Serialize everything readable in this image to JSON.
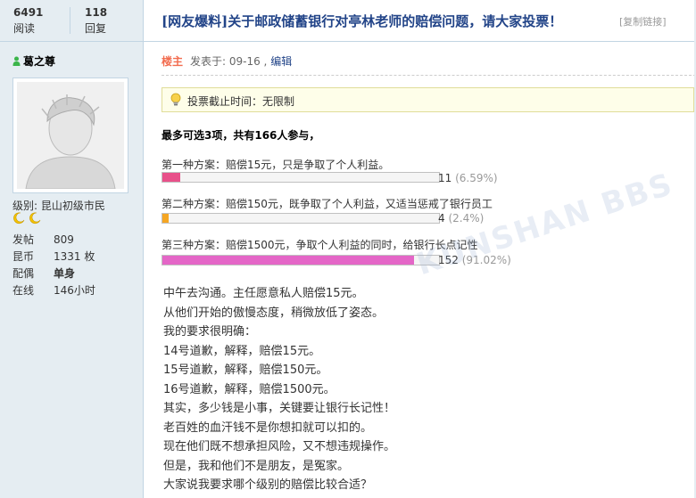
{
  "stats": {
    "views_value": "6491",
    "views_label": "阅读",
    "replies_value": "118",
    "replies_label": "回复"
  },
  "author": {
    "name": "葛之尊",
    "level": "级别: 昆山初级市民",
    "info": [
      {
        "key": "发帖",
        "value": "809"
      },
      {
        "key": "昆币",
        "value": "1331 枚"
      },
      {
        "key": "配偶",
        "value": "单身"
      },
      {
        "key": "在线",
        "value": "146小时"
      }
    ]
  },
  "thread": {
    "title": "[网友爆料]关于邮政储蓄银行对亭林老师的赔偿问题，请大家投票！",
    "copy_link": "[复制链接]"
  },
  "post": {
    "owner_label": "楼主",
    "posted_at": "发表于: 09-16 ,",
    "edit_label": "编辑"
  },
  "poll": {
    "deadline": "投票截止时间：无限制",
    "summary": "最多可选3项，共有166人参与，",
    "options": [
      {
        "label": "第一种方案：赔偿15元，只是争取了个人利益。",
        "count": "11",
        "percent": "(6.59%)",
        "fraction": 0.0659,
        "color": "#e8508a"
      },
      {
        "label": "第二种方案：赔偿150元，既争取了个人利益，又适当惩戒了银行员工",
        "count": "4",
        "percent": "(2.4%)",
        "fraction": 0.024,
        "color": "#f5a623"
      },
      {
        "label": "第三种方案：赔偿1500元，争取个人利益的同时，给银行长点记性",
        "count": "152",
        "percent": "(91.02%)",
        "fraction": 0.9102,
        "color": "#e466c7"
      }
    ]
  },
  "content": {
    "lines": [
      "中午去沟通。主任愿意私人赔偿15元。",
      "从他们开始的傲慢态度，稍微放低了姿态。",
      "我的要求很明确：",
      "14号道歉，解释，赔偿15元。",
      "15号道歉，解释，赔偿150元。",
      "16号道歉，解释，赔偿1500元。",
      "其实，多少钱是小事，关键要让银行长记性！",
      "老百姓的血汗钱不是你想扣就可以扣的。",
      "现在他们既不想承担风险，又不想违规操作。",
      "但是，我和他们不是朋友，是冤家。",
      "大家说我要求哪个级别的赔偿比较合适？"
    ]
  },
  "watermark": "KUNSHAN BBS",
  "icons": {
    "online": "user-online-icon",
    "moon": "moon-level-icon",
    "bulb": "lightbulb-icon",
    "avatar": "default-avatar"
  },
  "colors": {
    "sidebar_bg": "#e5edf2",
    "title": "#224488",
    "owner": "#f26c4f",
    "notice_bg": "#fefee9"
  }
}
